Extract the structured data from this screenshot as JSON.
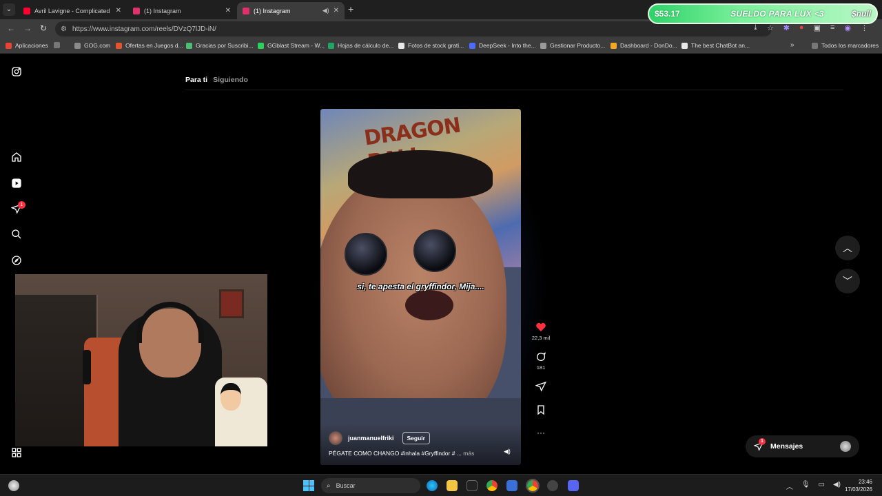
{
  "browser": {
    "tabs": [
      {
        "title": "Avril Lavigne - Complicated (Of",
        "favicon_color": "#ff0033",
        "active": false
      },
      {
        "title": "(1) Instagram",
        "favicon_color": "#e1306c",
        "active": false
      },
      {
        "title": "(1) Instagram",
        "favicon_color": "#e1306c",
        "active": true
      }
    ],
    "url": "https://www.instagram.com/reels/DVzQ7lJD-iN/",
    "bookmarks": [
      {
        "label": "Aplicaciones",
        "color": "#ea4335"
      },
      {
        "label": "GOG.com",
        "color": "#8a8a8a"
      },
      {
        "label": "Ofertas en Juegos d...",
        "color": "#e5532d"
      },
      {
        "label": "Gracias por Suscribi...",
        "color": "#4bbf73"
      },
      {
        "label": "GGblast Stream - W...",
        "color": "#2ad15a"
      },
      {
        "label": "Hojas de cálculo de...",
        "color": "#1fa463"
      },
      {
        "label": "Fotos de stock grati...",
        "color": "#e8e8e8"
      },
      {
        "label": "DeepSeek - Into the...",
        "color": "#4d6bfe"
      },
      {
        "label": "Gestionar Producto...",
        "color": "#9a9a9a"
      },
      {
        "label": "Dashboard - DonDo...",
        "color": "#f5a623"
      },
      {
        "label": "The best ChatBot an...",
        "color": "#e8e8e8"
      }
    ],
    "all_bookmarks": "Todos los marcadores"
  },
  "stream_overlay": {
    "amount": "$53.17",
    "goal": "SUELDO PARA LUX <3",
    "signature": "$null"
  },
  "instagram": {
    "feed_tabs": {
      "for_you": "Para ti",
      "following": "Siguiendo"
    },
    "notif_count": "1",
    "reel": {
      "poster_text": "DRAGON BALL",
      "overlay_caption": "si, te apesta el gryffindor, Mija....",
      "author": "juanmanuelfriki",
      "follow_label": "Seguir",
      "description": "PÉGATE COMO CHANGO #inhala #Gryffindor # ...",
      "more": "más",
      "likes": "22,3 mil",
      "comments": "181"
    },
    "messages": {
      "label": "Mensajes",
      "badge": "1"
    }
  },
  "taskbar": {
    "search_placeholder": "Buscar",
    "time": "23:46",
    "date": "17/03/2026"
  },
  "colors": {
    "accent_like": "#ff3040",
    "ig_bg": "#000000",
    "start_blue": "#4cc2ff"
  }
}
